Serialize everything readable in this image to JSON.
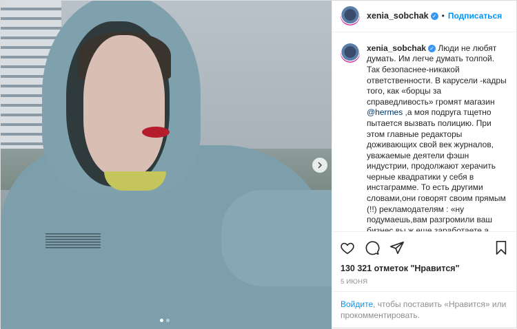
{
  "header": {
    "username": "xenia_sobchak",
    "separator": "•",
    "follow_label": "Подписаться"
  },
  "caption": {
    "username": "xenia_sobchak",
    "text_before_mention": "Люди не любят думать. Им легче думать толпой. Так безопаснее-никакой ответственности. В карусели -кадры того, как «борцы за справедливость» громят магазин",
    "mention": "@hermes",
    "text_after_mention": ",а моя подруга тщетно пытается вызвать полицию. При этом главные редакторы доживающих свой век журналов, уважаемые деятели фэшн индустрии, продолжают херачить черные квадратики у себя в инстаграмме. То есть другими словами,они говорят своим прямым (!!) рекламодателям : «ну подумаешь,вам разгромили ваш бизнес,вы ж еще заработаете,а люди негодуют, за права чернокожих борятся». 🙈"
  },
  "actions": {
    "like": "heart-icon",
    "comment": "comment-icon",
    "share": "share-icon",
    "save": "bookmark-icon"
  },
  "likes_text": "130 321 отметок \"Нравится\"",
  "date_text": "5 июня",
  "login_prompt": {
    "link": "Войдите",
    "text": ", чтобы поставить «Нравится» или прокомментировать."
  },
  "carousel": {
    "current": 1,
    "total": 2
  },
  "colors": {
    "accent": "#0095f6",
    "verified": "#3897f0",
    "link_dark": "#00376b",
    "muted": "#8e8e8e"
  }
}
